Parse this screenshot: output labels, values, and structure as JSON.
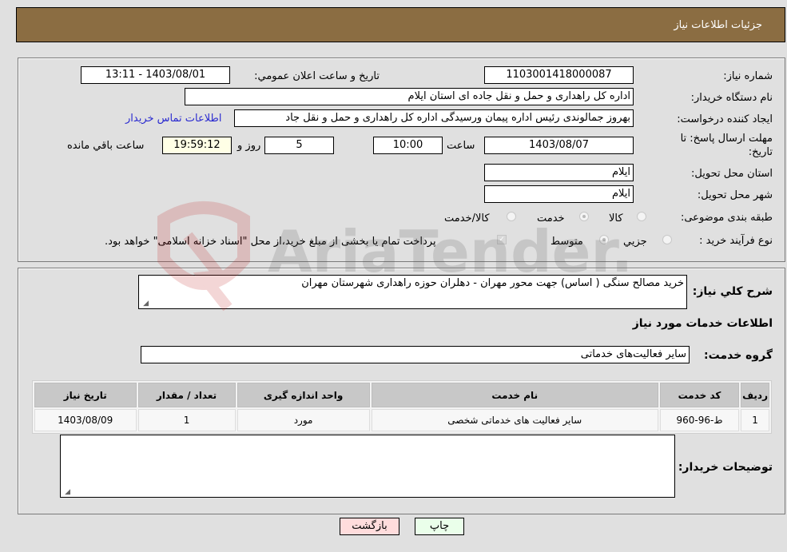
{
  "header": {
    "title": "جزئیات اطلاعات نیاز"
  },
  "form": {
    "need_number": {
      "label": "شماره نیاز:",
      "value": "1103001418000087"
    },
    "announce_datetime": {
      "label": "تاریخ و ساعت اعلان عمومي:",
      "value": "1403/08/01 - 13:11"
    },
    "buyer_org": {
      "label": "نام دستگاه خريدار:",
      "value": "اداره کل راهداری و حمل و نقل جاده ای استان ایلام"
    },
    "creator": {
      "label": "ایجاد کننده درخواست:",
      "value": "بهروز جمالوندی رئیس اداره پیمان ورسیدگی  اداره کل راهداری و حمل و نقل جاد"
    },
    "contact_link": "اطلاعات تماس خریدار",
    "deadline": {
      "label_line1": "مهلت ارسال پاسخ: تا",
      "label_line2": "تاریخ:",
      "date": "1403/08/07",
      "time_label": "ساعت",
      "time": "10:00",
      "days": "5",
      "days_label": "روز و",
      "remaining": "19:59:12",
      "remaining_label": "ساعت باقي مانده"
    },
    "province": {
      "label": "استان محل تحویل:",
      "value": "ایلام"
    },
    "city": {
      "label": "شهر محل تحویل:",
      "value": "ایلام"
    },
    "category": {
      "label": "طبقه بندی موضوعی:",
      "options": [
        "کالا",
        "خدمت",
        "کالا/خدمت"
      ],
      "selected": "خدمت"
    },
    "process_type": {
      "label": "نوع فرآیند خرید :",
      "options": [
        "جزيي",
        "متوسط"
      ],
      "selected": "متوسط",
      "treasury_note": "پرداخت تمام یا بخشی از مبلغ خرید،از محل \"اسناد خزانه اسلامی\" خواهد بود."
    }
  },
  "details": {
    "summary_label": "شرح کلي نياز:",
    "summary_value": "خرید مصالح سنگی ( اساس) جهت محور مهران - دهلران حوزه راهداری شهرستان مهران",
    "services_heading": "اطلاعات خدمات مورد نیاز",
    "service_group_label": "گروه خدمت:",
    "service_group_value": "سایر فعالیت‌های خدماتی",
    "table": {
      "headers": [
        "رديف",
        "کد خدمت",
        "نام خدمت",
        "واحد اندازه گیری",
        "تعداد / مقدار",
        "تاریخ نیاز"
      ],
      "rows": [
        [
          "1",
          "ط-96-960",
          "سایر فعالیت های خدماتی شخصی",
          "مورد",
          "1",
          "1403/08/09"
        ]
      ]
    },
    "buyer_notes_label": "توضیحات خریدار:",
    "buyer_notes_value": ""
  },
  "buttons": {
    "print": "چاپ",
    "back": "بازگشت"
  },
  "colors": {
    "header_bg": "#8b6d42",
    "link": "#2a2ad0",
    "print_bg": "#eaffea",
    "back_bg": "#ffdcdc"
  }
}
